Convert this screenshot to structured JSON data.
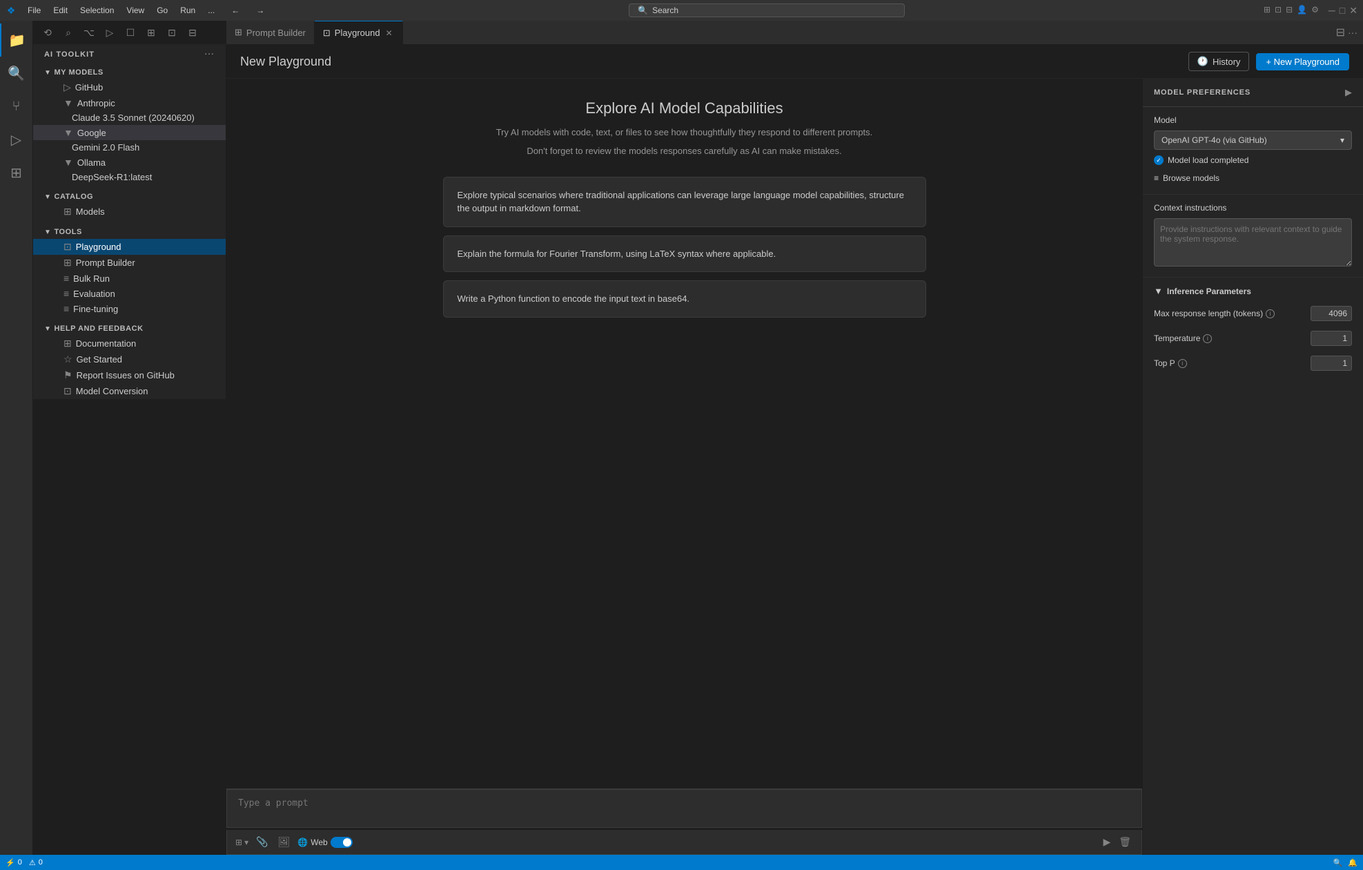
{
  "titleBar": {
    "icon": "❖",
    "menus": [
      "File",
      "Edit",
      "Selection",
      "View",
      "Go",
      "Run",
      "..."
    ],
    "search": "Search",
    "navBack": "←",
    "navForward": "→"
  },
  "toolbar": {
    "icons": [
      "⟲",
      "⌕",
      "⌥",
      "▷",
      "☐",
      "⊞",
      "⊡",
      "⊟"
    ]
  },
  "sidebar": {
    "header": "AI TOOLKIT",
    "sections": {
      "myModels": {
        "label": "MY MODELS",
        "providers": [
          {
            "name": "GitHub",
            "models": []
          },
          {
            "name": "Anthropic",
            "models": [
              "Claude 3.5 Sonnet (20240620)"
            ]
          },
          {
            "name": "Google",
            "models": [
              "Gemini 2.0 Flash"
            ]
          },
          {
            "name": "Ollama",
            "models": [
              "DeepSeek-R1:latest"
            ]
          }
        ]
      },
      "catalog": {
        "label": "CATALOG",
        "items": [
          "Models"
        ]
      },
      "tools": {
        "label": "TOOLS",
        "items": [
          "Playground",
          "Prompt Builder",
          "Bulk Run",
          "Evaluation",
          "Fine-tuning"
        ]
      },
      "helpAndFeedback": {
        "label": "HELP AND FEEDBACK",
        "items": [
          "Documentation",
          "Get Started",
          "Report Issues on GitHub",
          "Model Conversion"
        ]
      }
    }
  },
  "tabs": [
    {
      "label": "Prompt Builder",
      "icon": "⊞",
      "active": false
    },
    {
      "label": "Playground",
      "icon": "⊡",
      "active": true,
      "closeable": true
    }
  ],
  "contentHeader": {
    "title": "New Playground",
    "historyBtn": "History",
    "newPlaygroundBtn": "+ New Playground"
  },
  "playground": {
    "exploreTitle": "Explore AI Model Capabilities",
    "exploreDesc1": "Try AI models with code, text, or files to see how thoughtfully they respond to different prompts.",
    "exploreDesc2": "Don't forget to review the models responses carefully as AI can make mistakes.",
    "promptCards": [
      "Explore typical scenarios where traditional applications can leverage large language model capabilities, structure the output in markdown format.",
      "Explain the formula for Fourier Transform, using LaTeX syntax where applicable.",
      "Write a Python function to encode the input text in base64."
    ]
  },
  "inputArea": {
    "placeholder": "Type a prompt",
    "webLabel": "Web",
    "webEnabled": true
  },
  "rightPanel": {
    "title": "MODEL PREFERENCES",
    "model": {
      "label": "Model",
      "selectedModel": "OpenAI GPT-4o (via GitHub)",
      "loadedText": "Model load completed",
      "browseText": "Browse models"
    },
    "contextInstructions": {
      "label": "Context instructions",
      "placeholder": "Provide instructions with relevant context to guide the system response."
    },
    "inferenceParams": {
      "title": "Inference Parameters",
      "params": [
        {
          "label": "Max response length (tokens)",
          "value": "4096"
        },
        {
          "label": "Temperature",
          "value": "1"
        },
        {
          "label": "Top P",
          "value": "1"
        }
      ]
    }
  },
  "statusBar": {
    "leftItems": [
      "⚡ 0",
      "⚠ 0"
    ],
    "rightItems": [
      "🔍",
      "🔔"
    ]
  }
}
